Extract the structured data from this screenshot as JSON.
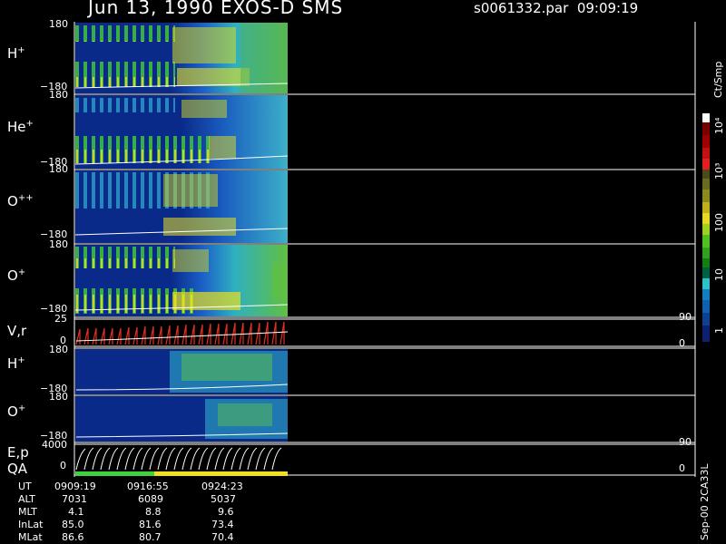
{
  "header": {
    "title": "Jun 13, 1990   EXOS-D SMS",
    "file": "s0061332.par",
    "time": "09:09:19"
  },
  "panels": [
    {
      "species_html": "H<sup>+</sup>",
      "top_tick": "180",
      "bottom_tick": "−180"
    },
    {
      "species_html": "He<sup>+</sup>",
      "top_tick": "180",
      "bottom_tick": "−180"
    },
    {
      "species_html": "O<sup>++</sup>",
      "top_tick": "180",
      "bottom_tick": "−180"
    },
    {
      "species_html": "O<sup>+</sup>",
      "top_tick": "180",
      "bottom_tick": "−180"
    },
    {
      "species_html": "V,r",
      "top_tick": "25",
      "bottom_tick": "0",
      "right_top": "90",
      "right_bottom": "0"
    },
    {
      "species_html": "H<sup>+</sup>",
      "top_tick": "180",
      "bottom_tick": "−180"
    },
    {
      "species_html": "O<sup>+</sup>",
      "top_tick": "180",
      "bottom_tick": "−180"
    },
    {
      "species_html": "E,p<br>QA",
      "top_tick": "4000",
      "bottom_tick": "0",
      "right_top": "90",
      "right_bottom": "0"
    }
  ],
  "colorbar": {
    "unit": "Ct/Smp",
    "labels": [
      "10⁴",
      "10³",
      "100",
      "10",
      "1"
    ]
  },
  "footer": {
    "rows": [
      {
        "label": "UT",
        "values": [
          "0909:19",
          "0916:55",
          "0924:23"
        ]
      },
      {
        "label": "ALT",
        "values": [
          "7031",
          "6089",
          "5037"
        ]
      },
      {
        "label": "MLT",
        "values": [
          "4.1",
          "8.8",
          "9.6"
        ]
      },
      {
        "label": "InLat",
        "values": [
          "85.0",
          "81.6",
          "73.4"
        ]
      },
      {
        "label": "MLat",
        "values": [
          "86.6",
          "80.7",
          "70.4"
        ]
      }
    ],
    "stamp": "Sep-00 2CA33L"
  }
}
